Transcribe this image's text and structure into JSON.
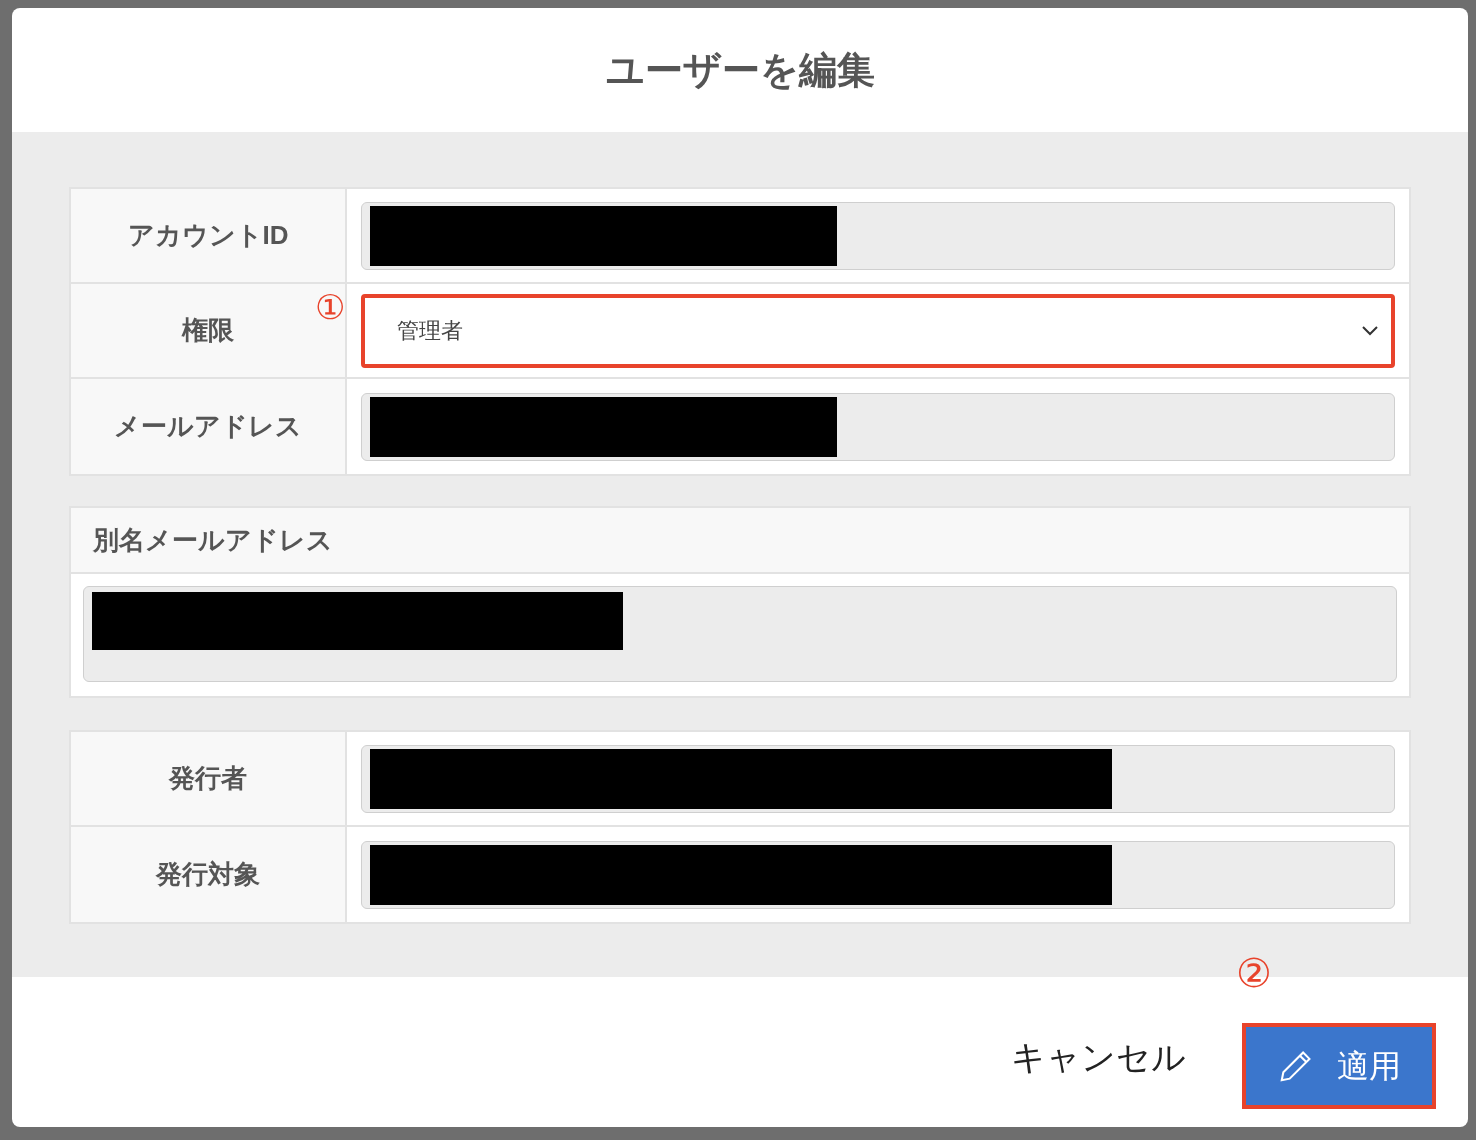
{
  "dialog": {
    "title": "ユーザーを編集"
  },
  "fields": [
    {
      "label": "アカウントID",
      "kind": "redacted"
    },
    {
      "label": "権限",
      "kind": "select",
      "value": "管理者",
      "marker": "①",
      "highlighted": true
    },
    {
      "label": "メールアドレス",
      "kind": "redacted"
    }
  ],
  "alias_section": {
    "title": "別名メールアドレス"
  },
  "fields2": [
    {
      "label": "発行者",
      "kind": "redacted"
    },
    {
      "label": "発行対象",
      "kind": "redacted"
    }
  ],
  "footer": {
    "cancel": "キャンセル",
    "apply": {
      "label": "適用",
      "marker": "②",
      "highlighted": true
    }
  }
}
